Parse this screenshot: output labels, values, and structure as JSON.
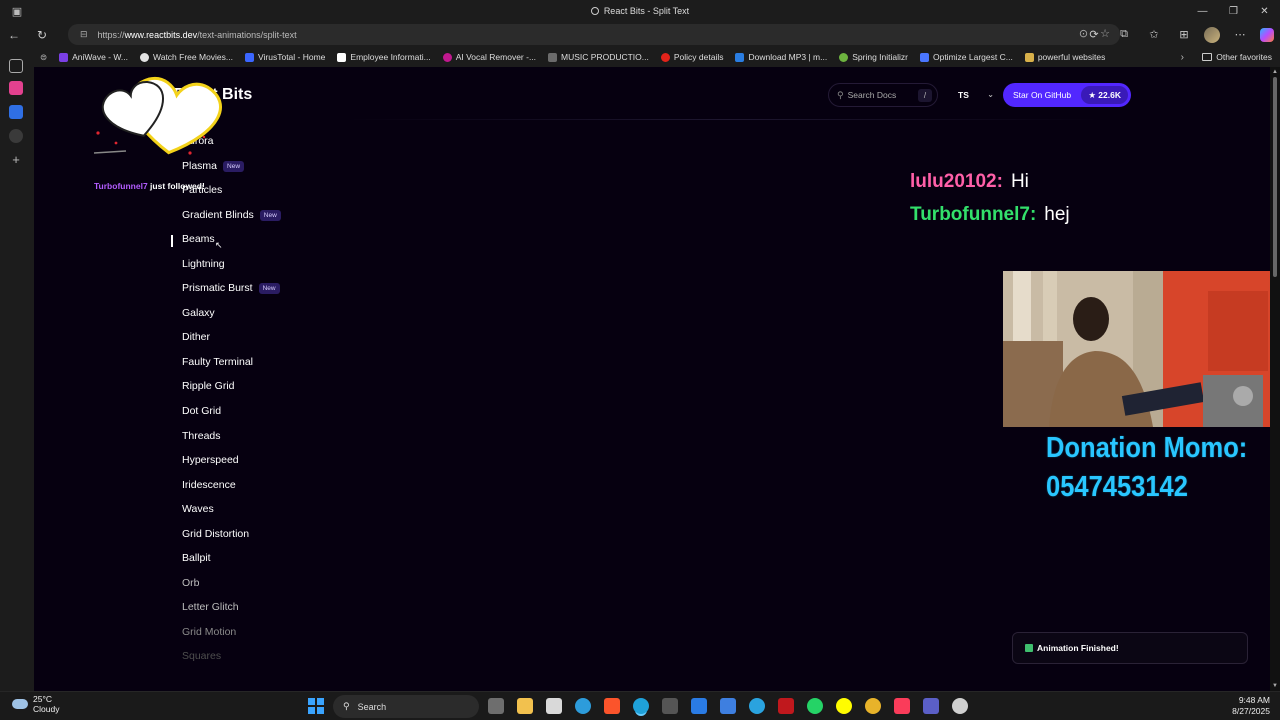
{
  "browser": {
    "window_title": "React Bits - Split Text",
    "url_prefix": "https://",
    "url_host": "www.reactbits.dev",
    "url_path": "/text-animations/split-text",
    "favorites": [
      {
        "label": "AniWave - W...",
        "color": "#7b3fe4"
      },
      {
        "label": "Watch Free Movies...",
        "color": "#e3e3e3"
      },
      {
        "label": "VirusTotal - Home",
        "color": "#3b66ff"
      },
      {
        "label": "Employee Informati...",
        "color": "#ffffff"
      },
      {
        "label": "AI Vocal Remover -...",
        "color": "#c1188f"
      },
      {
        "label": "MUSIC PRODUCTIO...",
        "color": "#6b6b6b"
      },
      {
        "label": "Policy details",
        "color": "#e2231a"
      },
      {
        "label": "Download MP3 | m...",
        "color": "#2a7de1"
      },
      {
        "label": "Spring Initializr",
        "color": "#6db33f"
      },
      {
        "label": "Optimize Largest C...",
        "color": "#4a76ff"
      },
      {
        "label": "powerful websites",
        "color": "#d8b04a"
      }
    ],
    "other_favorites": "Other favorites"
  },
  "site": {
    "brand": "React Bits",
    "search_placeholder": "Search Docs",
    "search_shortcut": "/",
    "language": "TS",
    "github_label": "Star On GitHub",
    "github_stars": "★ 22.6K",
    "accent_color": "#5227ff"
  },
  "nav": {
    "items": [
      {
        "label": "Aurora",
        "badge": ""
      },
      {
        "label": "Plasma",
        "badge": "New"
      },
      {
        "label": "Particles",
        "badge": ""
      },
      {
        "label": "Gradient Blinds",
        "badge": "New"
      },
      {
        "label": "Beams",
        "badge": ""
      },
      {
        "label": "Lightning",
        "badge": ""
      },
      {
        "label": "Prismatic Burst",
        "badge": "New"
      },
      {
        "label": "Galaxy",
        "badge": ""
      },
      {
        "label": "Dither",
        "badge": ""
      },
      {
        "label": "Faulty Terminal",
        "badge": ""
      },
      {
        "label": "Ripple Grid",
        "badge": ""
      },
      {
        "label": "Dot Grid",
        "badge": ""
      },
      {
        "label": "Threads",
        "badge": ""
      },
      {
        "label": "Hyperspeed",
        "badge": ""
      },
      {
        "label": "Iridescence",
        "badge": ""
      },
      {
        "label": "Waves",
        "badge": ""
      },
      {
        "label": "Grid Distortion",
        "badge": ""
      },
      {
        "label": "Ballpit",
        "badge": ""
      },
      {
        "label": "Orb",
        "badge": ""
      },
      {
        "label": "Letter Glitch",
        "badge": ""
      },
      {
        "label": "Grid Motion",
        "badge": ""
      },
      {
        "label": "Squares",
        "badge": ""
      }
    ]
  },
  "overlay": {
    "follow_name": "Turbofunnel7",
    "follow_text": " just followed!",
    "chat": [
      {
        "user": "lulu20102:",
        "message": "Hi"
      },
      {
        "user": "Turbofunnel7:",
        "message": "hej"
      }
    ],
    "donation_line1": "Donation Momo:",
    "donation_line2": "0547453142"
  },
  "toast": {
    "message": "Animation Finished!"
  },
  "taskbar": {
    "temperature": "25°C",
    "condition": "Cloudy",
    "search_label": "Search",
    "time": "9:48 AM",
    "date": "8/27/2025",
    "apps": [
      {
        "name": "task-view",
        "color": "#6e6e6e"
      },
      {
        "name": "file-explorer",
        "color": "#f2c14e"
      },
      {
        "name": "store",
        "color": "#d9d9d9"
      },
      {
        "name": "copilot-app",
        "color": "#2d9cdb"
      },
      {
        "name": "brave",
        "color": "#fb542b"
      },
      {
        "name": "edge",
        "color": "#1fa1d9"
      },
      {
        "name": "word",
        "color": "#555"
      },
      {
        "name": "vscode",
        "color": "#2a7be4"
      },
      {
        "name": "todo",
        "color": "#3e7fe0"
      },
      {
        "name": "telegram",
        "color": "#2aa3df"
      },
      {
        "name": "redapp",
        "color": "#c0181d"
      },
      {
        "name": "whatsapp",
        "color": "#25d366"
      },
      {
        "name": "snapchat",
        "color": "#fffc00"
      },
      {
        "name": "chrome",
        "color": "#e8b32a"
      },
      {
        "name": "music",
        "color": "#fa3c5a"
      },
      {
        "name": "teams",
        "color": "#5b5fc7"
      },
      {
        "name": "obs",
        "color": "#cfcfcf"
      }
    ]
  }
}
